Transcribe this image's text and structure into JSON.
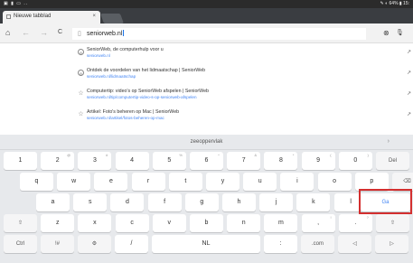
{
  "status": {
    "left_icons": "▣ ▮ ▭ ..",
    "right_text": "✎ ◐ 64% ▮ 15:"
  },
  "tab": {
    "title": "Nieuwe tabblad",
    "close": "×"
  },
  "toolbar": {
    "home_icon": "⌂",
    "back_icon": "←",
    "forward_icon": "→",
    "reload_icon": "C",
    "page_icon": "▯",
    "url_text": "seniorweb.nl",
    "clear_icon": "⊗",
    "mic_icon": "🎙"
  },
  "suggestions": [
    {
      "icon": "◎",
      "title": "SeniorWeb, de computerhulp voor u",
      "url": "seniorweb.nl",
      "arrow": "↗"
    },
    {
      "icon": "◎",
      "title": "Ontdek de voordelen van het lidmaatschap | SeniorWeb",
      "url": "seniorweb.nl/lidmaatschap",
      "arrow": "↗"
    },
    {
      "icon": "☆",
      "title": "Computertip: video's op SeniorWeb afspelen | SeniorWeb",
      "url": "seniorweb.nl/tip/computertip-video-s-op-seniorweb-afspelen",
      "arrow": "↗"
    },
    {
      "icon": "☆",
      "title": "Artikel: Foto's beheren op Mac | SeniorWeb",
      "url": "seniorweb.nl/artikel/fotos-beheren-op-mac",
      "arrow": "↗"
    }
  ],
  "keyboard": {
    "prediction": "zeeoppervlak",
    "prediction_arrow": "›",
    "row1": [
      {
        "k": "1",
        "s": ""
      },
      {
        "k": "2",
        "s": "@"
      },
      {
        "k": "3",
        "s": "#"
      },
      {
        "k": "4",
        "s": ""
      },
      {
        "k": "5",
        "s": "%"
      },
      {
        "k": "6",
        "s": "^"
      },
      {
        "k": "7",
        "s": "&"
      },
      {
        "k": "8",
        "s": "*"
      },
      {
        "k": "9",
        "s": "("
      },
      {
        "k": "0",
        "s": ")"
      },
      {
        "k": "Del",
        "s": ""
      }
    ],
    "row2": [
      "q",
      "w",
      "e",
      "r",
      "t",
      "y",
      "u",
      "i",
      "o",
      "p",
      "⌫"
    ],
    "row3": [
      "a",
      "s",
      "d",
      "f",
      "g",
      "h",
      "j",
      "k",
      "l",
      "Ga"
    ],
    "row4": [
      "⇧",
      "z",
      "x",
      "c",
      "v",
      "b",
      "n",
      "m",
      ",",
      ".",
      "⇧"
    ],
    "row4_sup": [
      "",
      "",
      "",
      "",
      "",
      "",
      "",
      "",
      "!",
      "?",
      ""
    ],
    "row5": [
      "Ctrl",
      "!#",
      "⚙",
      "/",
      "NL",
      ":",
      ".com",
      "◁",
      "▷"
    ]
  }
}
